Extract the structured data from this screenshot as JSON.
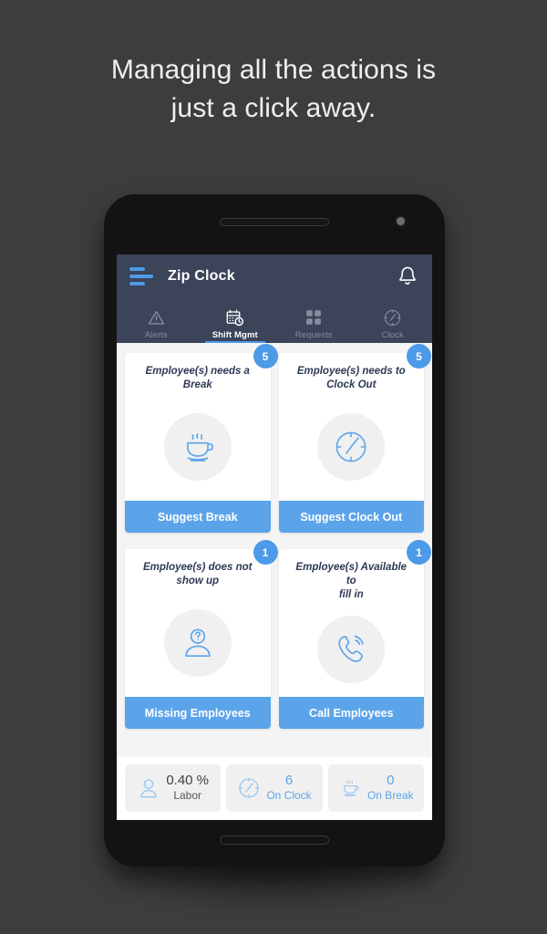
{
  "promo": {
    "headline_line1": "Managing all the actions is",
    "headline_line2": "just a click away."
  },
  "app": {
    "title": "Zip Clock",
    "menu_icon": "hamburger-icon",
    "notification_icon": "bell-icon",
    "header_bg": "#3c445a",
    "accent": "#4c9ae8"
  },
  "tabs": [
    {
      "label": "Alerts",
      "icon": "warning-triangle-icon",
      "active": false
    },
    {
      "label": "Shift Mgmt",
      "icon": "calendar-clock-icon",
      "active": true
    },
    {
      "label": "Requests",
      "icon": "grid-squares-icon",
      "active": false
    },
    {
      "label": "Clock",
      "icon": "clock-icon",
      "active": false
    }
  ],
  "cards": [
    {
      "badge": "5",
      "title_line1": "Employee(s) needs a",
      "title_line2": "Break",
      "icon": "coffee-cup-icon",
      "button_label": "Suggest Break"
    },
    {
      "badge": "5",
      "title_line1": "Employee(s) needs to",
      "title_line2": "Clock Out",
      "icon": "clock-icon",
      "button_label": "Suggest Clock Out"
    },
    {
      "badge": "1",
      "title_line1": "Employee(s) does not",
      "title_line2": "show up",
      "icon": "person-question-icon",
      "button_label": "Missing Employees"
    },
    {
      "badge": "1",
      "title_line1": "Employee(s) Available to",
      "title_line2": "fill in",
      "icon": "phone-handset-icon",
      "button_label": "Call Employees"
    }
  ],
  "stats": [
    {
      "value": "0.40 %",
      "label": "Labor",
      "icon": "person-icon",
      "style": "dark"
    },
    {
      "value": "6",
      "label": "On Clock",
      "icon": "clock-icon",
      "style": "blue"
    },
    {
      "value": "0",
      "label": "On Break",
      "icon": "coffee-cup-icon",
      "style": "blue"
    }
  ]
}
